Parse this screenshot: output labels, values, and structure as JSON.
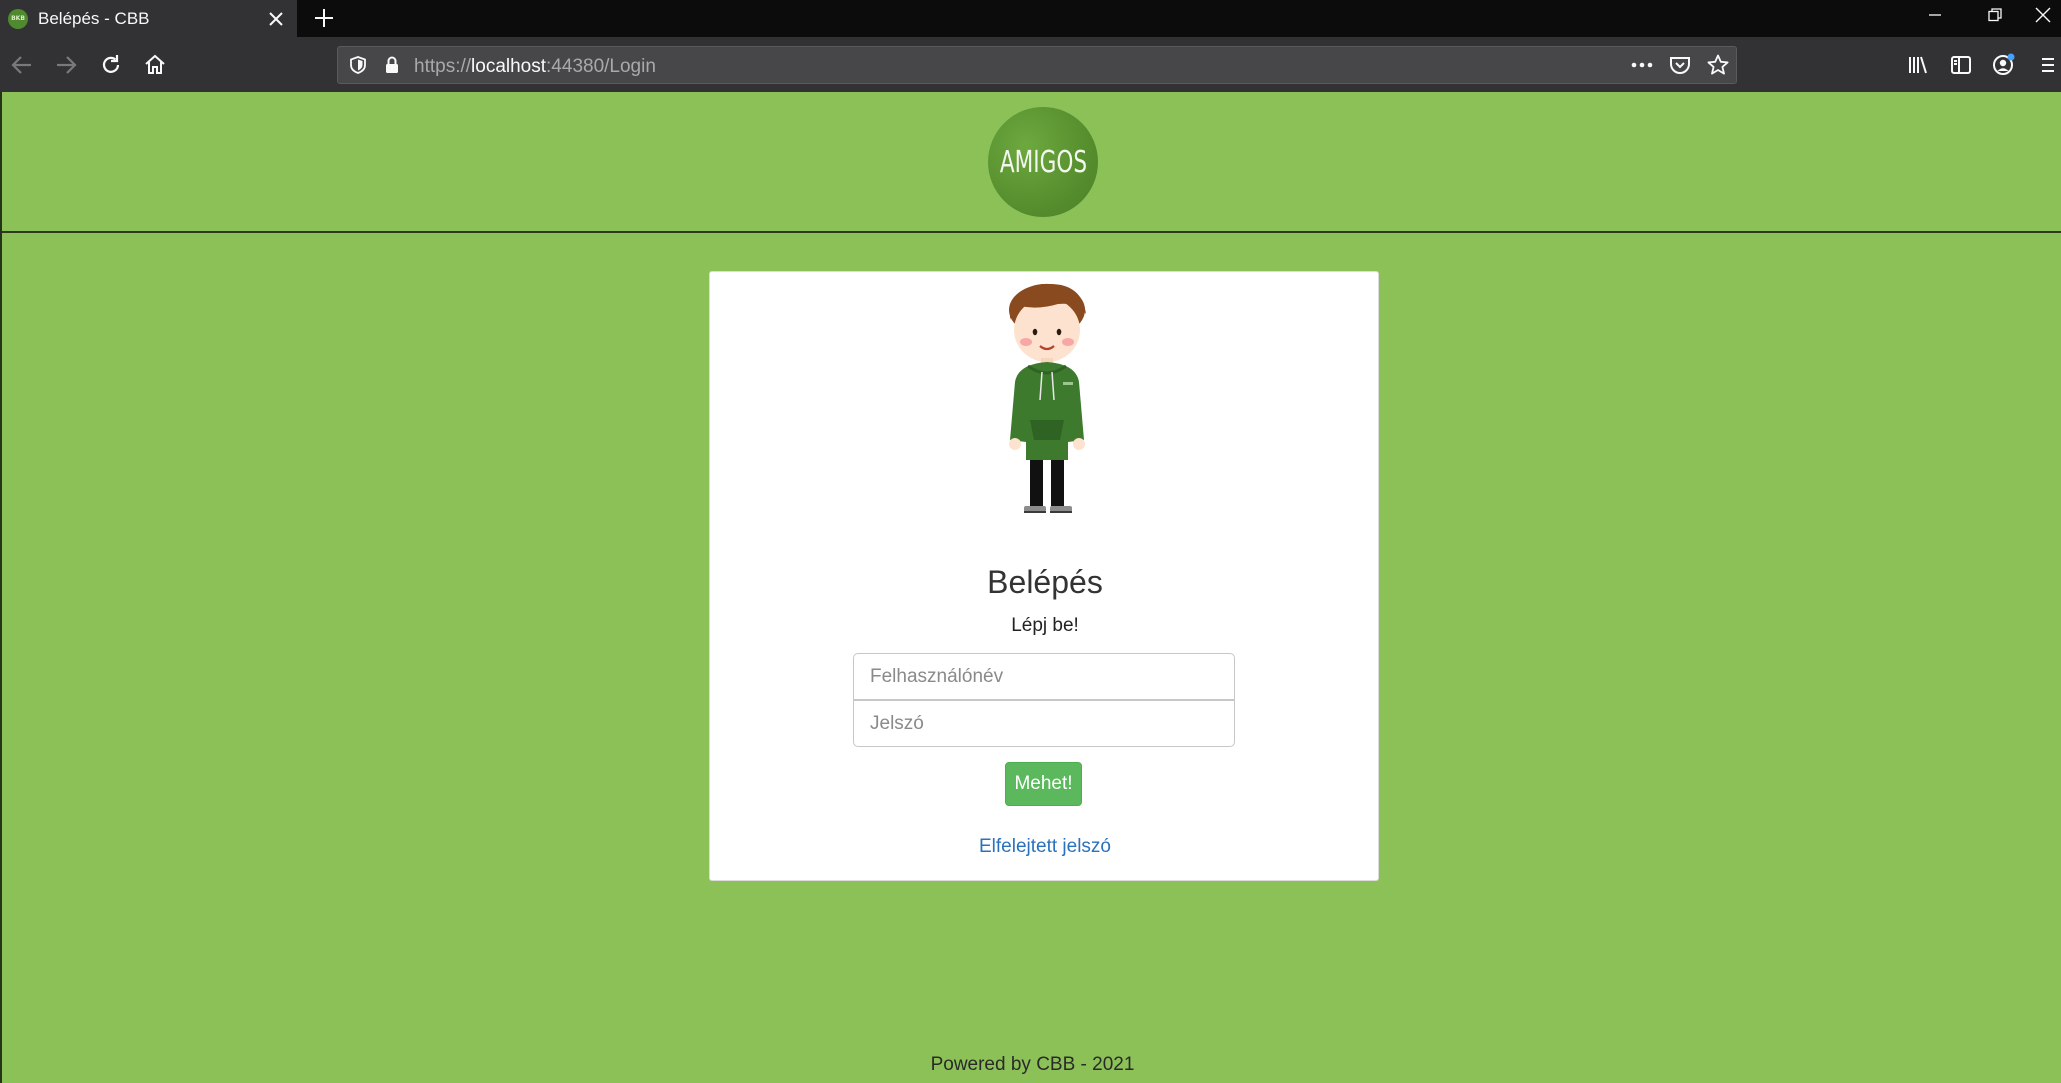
{
  "browser": {
    "tab": {
      "title": "Belépés - CBB",
      "favicon_text": "BKB"
    },
    "url": {
      "scheme": "https://",
      "host": "localhost",
      "rest": ":44380/Login"
    }
  },
  "header": {
    "logo_text": "AMIGOS"
  },
  "login": {
    "title": "Belépés",
    "subtitle": "Lépj be!",
    "username_placeholder": "Felhasználónév",
    "password_placeholder": "Jelszó",
    "submit_label": "Mehet!",
    "forgot_label": "Elfelejtett jelszó"
  },
  "footer": {
    "text": "Powered by CBB - 2021"
  },
  "colors": {
    "page_bg": "#8cc158",
    "button": "#5cb85c",
    "link": "#2a72bd",
    "logo": "#58912f"
  }
}
